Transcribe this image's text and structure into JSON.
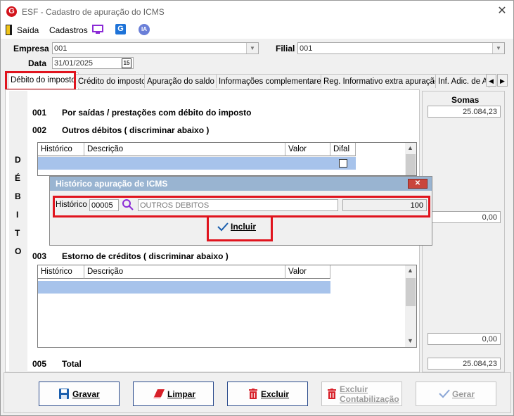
{
  "window": {
    "title": "ESF - Cadastro de apuração do ICMS",
    "logo_letter": "G"
  },
  "menu": {
    "exit": "Saída",
    "registers": "Cadastros",
    "ia_badge": "IA"
  },
  "form": {
    "company_label": "Empresa",
    "company_value": "001",
    "branch_label": "Filial",
    "branch_value": "001",
    "date_label": "Data",
    "date_value": "31/01/2025",
    "calendar_glyph": "15"
  },
  "tabs": [
    {
      "label": "Débito do imposto",
      "active": true
    },
    {
      "label": "Crédito do imposto"
    },
    {
      "label": "Apuração do saldo"
    },
    {
      "label": "Informações complementares"
    },
    {
      "label": "Reg. Informativo extra apuração"
    },
    {
      "label": "Inf. Adic. de A"
    }
  ],
  "debit": {
    "vertical_letters": [
      "D",
      "É",
      "B",
      "I",
      "T",
      "O"
    ],
    "s001_code": "001",
    "s001_label": "Por saídas / prestações com débito do imposto",
    "s002_code": "002",
    "s002_label": "Outros débitos ( discriminar abaixo )",
    "grid1_headers": [
      "Histórico",
      "Descrição",
      "Valor",
      "Difal"
    ],
    "s003_code": "003",
    "s003_label": "Estorno de créditos ( discriminar abaixo )",
    "grid2_headers": [
      "Histórico",
      "Descrição",
      "Valor"
    ],
    "s005_code": "005",
    "s005_label": "Total"
  },
  "somas": {
    "header": "Somas",
    "v001": "25.084,23",
    "v002": "0,00",
    "v003": "0,00",
    "v005": "25.084,23"
  },
  "dialog": {
    "title": "Histórico apuração de ICMS",
    "hist_label": "Histórico",
    "hist_code": "00005",
    "hist_description": "OUTROS DEBITOS",
    "hist_value": "100",
    "include_label": "Incluir"
  },
  "buttons": {
    "save": "Gravar",
    "clear": "Limpar",
    "delete": "Excluir",
    "delete_accounting_1": "Excluir",
    "delete_accounting_2": "Contabilização",
    "generate": "Gerar"
  }
}
